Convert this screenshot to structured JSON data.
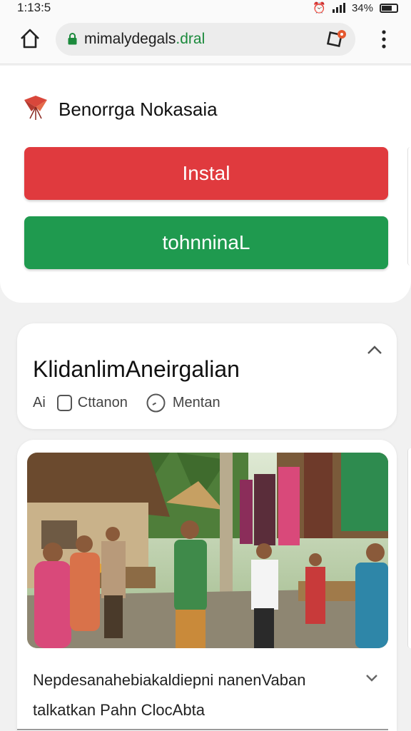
{
  "status_bar": {
    "time": "1:13:5",
    "battery": "34%"
  },
  "browser": {
    "url_main": "mimalydegals",
    "url_domain": ".dral"
  },
  "install_card": {
    "app_name": "Benorrga  Nokasaia",
    "install_label": "Instal",
    "terminal_label": "tohnninaL",
    "colors": {
      "install": "#e03a3e",
      "terminal": "#1f9a4f"
    }
  },
  "info_card": {
    "title": "KlidanlimAneirgalian",
    "ai_label": "Ai",
    "category_label": "Cttanon",
    "time_label": "Mentan"
  },
  "photo_card": {
    "caption_line1": "Nepdesanahebiakaldiepni nanenVaban",
    "caption_line2": "talkatkan Pahn  ClocAbta"
  },
  "icons": [
    "home-icon",
    "lock-icon",
    "tab-switcher-icon",
    "more-vert-icon",
    "chevron-up-icon",
    "square-icon",
    "clock-icon",
    "chevron-down-icon"
  ]
}
